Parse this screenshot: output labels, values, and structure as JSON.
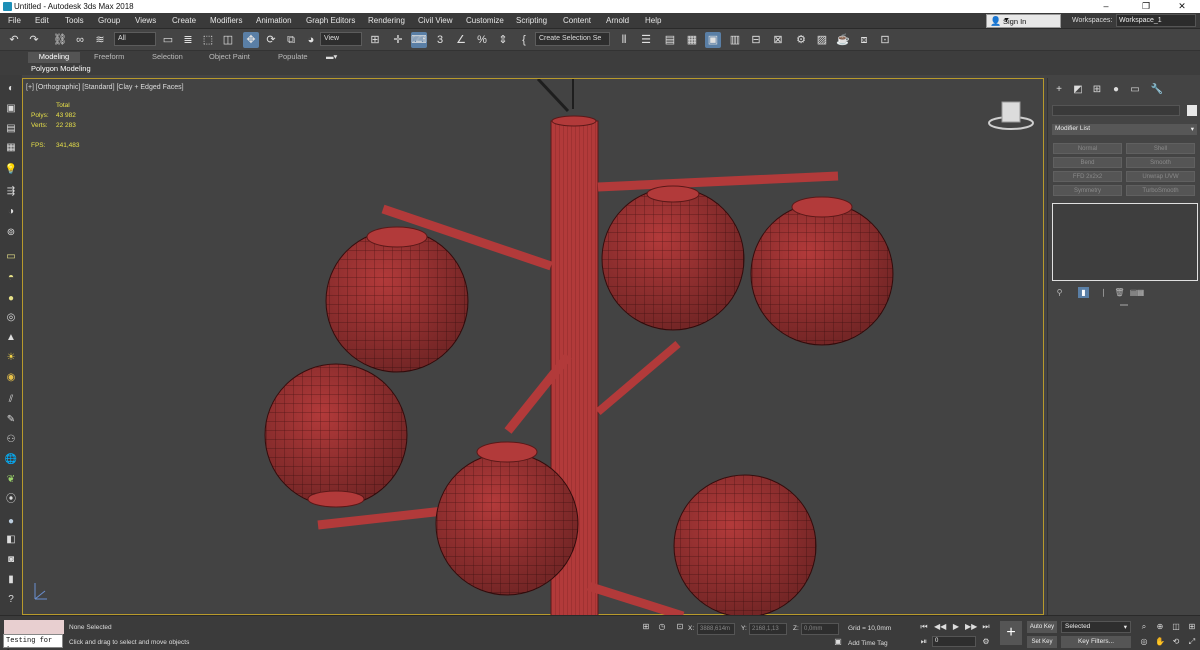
{
  "window": {
    "title": "Untitled - Autodesk 3ds Max 2018",
    "minimize": "–",
    "restore": "❐",
    "close": "✕"
  },
  "menu": {
    "items": [
      "File",
      "Edit",
      "Tools",
      "Group",
      "Views",
      "Create",
      "Modifiers",
      "Animation",
      "Graph Editors",
      "Rendering",
      "Civil View",
      "Customize",
      "Scripting",
      "Content",
      "Arnold",
      "Help"
    ],
    "sign_in": "Sign In",
    "workspaces_label": "Workspaces:",
    "workspace_value": "Workspace_1"
  },
  "toolbar": {
    "selection_filter": "All",
    "ref_coord": "View",
    "selection_set": "Create Selection Se",
    "icons": [
      "undo-icon",
      "redo-icon",
      "link-icon",
      "unlink-icon",
      "bind-space-warp-icon",
      "select-object-icon",
      "select-by-name-icon",
      "rect-region-icon",
      "window-crossing-icon",
      "select-move-icon",
      "select-rotate-icon",
      "select-scale-icon",
      "select-place-icon",
      "pivot-icon",
      "keyboard-shortcut-icon",
      "snap-toggle-icon",
      "angle-snap-icon",
      "percent-snap-icon",
      "spinner-snap-icon",
      "named-sets-icon",
      "mirror-icon",
      "align-icon",
      "layer-explorer-icon",
      "toggle-ribbon-icon",
      "curve-editor-icon",
      "schematic-view-icon",
      "material-editor-icon",
      "render-setup-icon",
      "rendered-frame-icon",
      "render-production-icon",
      "render-iterative-icon",
      "render-cloud-icon"
    ]
  },
  "ribbon": {
    "tabs": [
      "Modeling",
      "Freeform",
      "Selection",
      "Object Paint",
      "Populate"
    ],
    "active_tab": "Modeling",
    "panel_label": "Polygon Modeling"
  },
  "viewport": {
    "label": "[+] [Orthographic] [Standard] [Clay + Edged Faces]",
    "stats": {
      "total_label": "Total",
      "polys_label": "Polys:",
      "polys_value": "43 982",
      "verts_label": "Verts:",
      "verts_value": "22 283",
      "fps_label": "FPS:",
      "fps_value": "341,483"
    },
    "mesh_color": "#b23a3a",
    "background_color": "#434343"
  },
  "command_panel": {
    "modifier_list": "Modifier List",
    "modifier_buttons": [
      "Normal",
      "Shell",
      "Bend",
      "Smooth",
      "FFD 2x2x2",
      "Unwrap UVW",
      "Symmetry",
      "TurboSmooth"
    ]
  },
  "status": {
    "selection": "None Selected",
    "prompt": "Click and drag to select and move objects",
    "maxscript": "Testing for :",
    "x_label": "X:",
    "x_value": "3888,614m",
    "y_label": "Y:",
    "y_value": "2168,1,13",
    "z_label": "Z:",
    "z_value": "0,0mm",
    "grid": "Grid = 10,0mm",
    "add_time_tag": "Add Time Tag",
    "frame": "0",
    "auto_key": "Auto Key",
    "set_key": "Set Key",
    "key_mode": "Selected",
    "key_filters": "Key Filters..."
  }
}
